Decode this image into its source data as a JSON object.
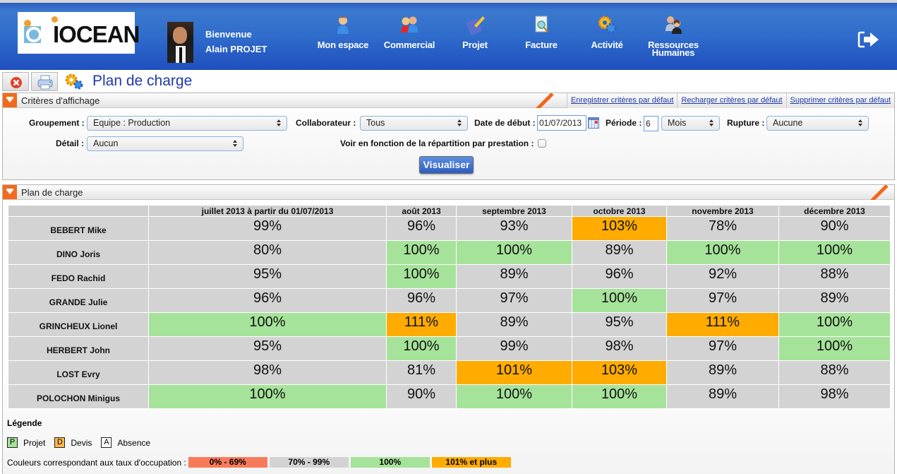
{
  "header": {
    "logo_text": "IOCEAN",
    "welcome_label": "Bienvenue",
    "user_name": "Alain PROJET",
    "nav": [
      {
        "label": "Mon espace",
        "icon": "user-icon"
      },
      {
        "label": "Commercial",
        "icon": "users-icon"
      },
      {
        "label": "Projet",
        "icon": "project-icon"
      },
      {
        "label": "Facture",
        "icon": "invoice-search-icon"
      },
      {
        "label": "Activité",
        "icon": "gears-icon"
      },
      {
        "label": "Ressources Humaines",
        "icon": "hr-icon"
      }
    ],
    "logout_icon": "logout-icon"
  },
  "toolbar": {
    "page_title": "Plan de charge",
    "close_icon": "close-icon",
    "print_icon": "print-icon"
  },
  "criteria": {
    "title": "Critères d'affichage",
    "links": [
      "Enregistrer critères par défaut",
      "Recharger critères par défaut",
      "Supprimer critères par défaut"
    ],
    "groupement_label": "Groupement :",
    "groupement_value": "Equipe : Production",
    "collaborateur_label": "Collaborateur :",
    "collaborateur_value": "Tous",
    "date_label": "Date de début :",
    "date_value": "01/07/2013",
    "periode_label": "Période :",
    "periode_value": "6",
    "periode_unit": "Mois",
    "rupture_label": "Rupture :",
    "rupture_value": "Aucune",
    "detail_label": "Détail :",
    "detail_value": "Aucun",
    "repartition_label": "Voir en fonction de la répartition par prestation :",
    "repartition_checked": false,
    "submit_label": "Visualiser"
  },
  "plan": {
    "title": "Plan de charge",
    "columns": [
      "juillet 2013 à partir du 01/07/2013",
      "août 2013",
      "septembre 2013",
      "octobre 2013",
      "novembre 2013",
      "décembre 2013"
    ],
    "rows": [
      {
        "name": "BEBERT Mike",
        "values": [
          99,
          96,
          93,
          103,
          78,
          90
        ]
      },
      {
        "name": "DINO Joris",
        "values": [
          80,
          100,
          100,
          89,
          100,
          100
        ]
      },
      {
        "name": "FEDO Rachid",
        "values": [
          95,
          100,
          89,
          96,
          92,
          88
        ]
      },
      {
        "name": "GRANDE Julie",
        "values": [
          96,
          96,
          97,
          100,
          97,
          89
        ]
      },
      {
        "name": "GRINCHEUX Lionel",
        "values": [
          100,
          111,
          89,
          95,
          111,
          100
        ]
      },
      {
        "name": "HERBERT John",
        "values": [
          95,
          100,
          99,
          98,
          97,
          100
        ]
      },
      {
        "name": "LOST Evry",
        "values": [
          98,
          81,
          101,
          103,
          89,
          88
        ]
      },
      {
        "name": "POLOCHON Minigus",
        "values": [
          100,
          90,
          100,
          100,
          89,
          98
        ]
      }
    ]
  },
  "legend": {
    "title": "Légende",
    "keys": [
      {
        "key": "P",
        "label": "Projet",
        "color": "#a6e39a"
      },
      {
        "key": "D",
        "label": "Devis",
        "color": "#ffb84d"
      },
      {
        "key": "A",
        "label": "Absence",
        "color": "#ffffff"
      }
    ],
    "rates_label": "Couleurs correspondant aux taux d'occupation :",
    "rates": [
      {
        "label": "0% - 69%",
        "color": "#f97a5a"
      },
      {
        "label": "70% - 99%",
        "color": "#d3d3d3"
      },
      {
        "label": "100%",
        "color": "#a6e39a"
      },
      {
        "label": "101% et plus",
        "color": "#ffab00"
      }
    ]
  }
}
